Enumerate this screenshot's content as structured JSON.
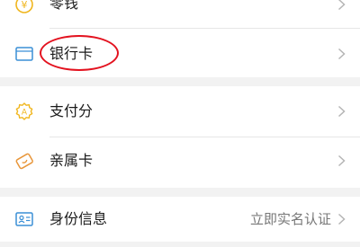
{
  "colors": {
    "icon_accent": "#f0b61e",
    "icon_blue": "#3a8fd6",
    "highlight_red": "#e3121f",
    "chevron": "#b5b5b5"
  },
  "rows": [
    {
      "label": "零钱",
      "icon": "coin-icon"
    },
    {
      "label": "银行卡",
      "icon": "bank-card-icon"
    },
    {
      "label": "支付分",
      "icon": "score-icon"
    },
    {
      "label": "亲属卡",
      "icon": "family-card-icon"
    },
    {
      "label": "身份信息",
      "icon": "id-card-icon",
      "extra": "立即实名认证"
    }
  ]
}
